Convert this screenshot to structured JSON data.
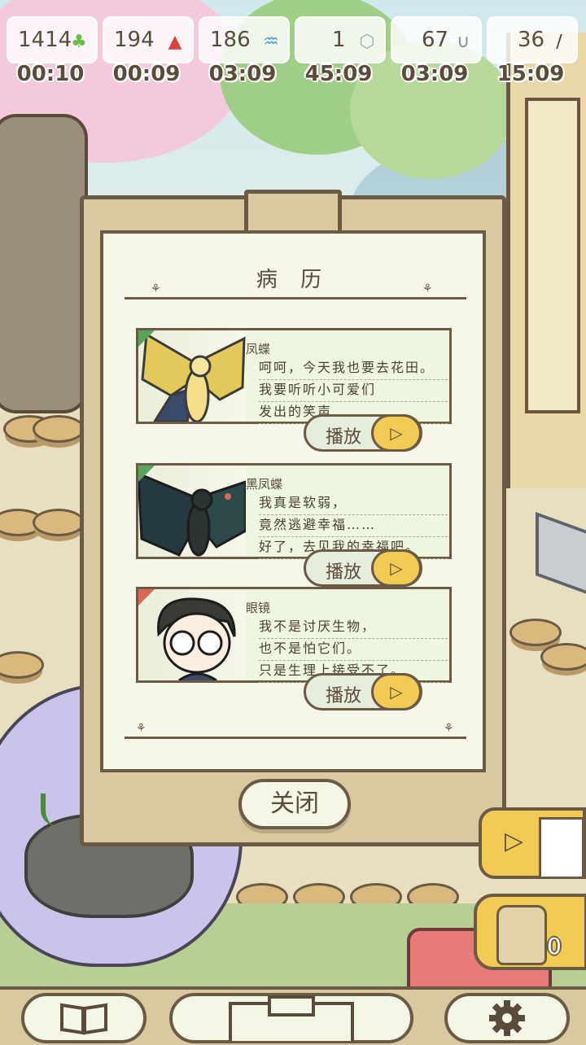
{
  "resources": [
    {
      "count": "1414",
      "timer": "00:10",
      "icon": "clover-icon"
    },
    {
      "count": "194",
      "timer": "00:09",
      "icon": "red-crystal-icon"
    },
    {
      "count": "186",
      "timer": "03:09",
      "icon": "water-drop-icon"
    },
    {
      "count": "1",
      "timer": "45:09",
      "icon": "shell-icon"
    },
    {
      "count": "67",
      "timer": "03:09",
      "icon": "paperclip-icon"
    },
    {
      "count": "36",
      "timer": "15:09",
      "icon": "feather-icon"
    }
  ],
  "dialog": {
    "title": "病 历",
    "close_label": "关闭"
  },
  "records": [
    {
      "speaker": "凤蝶",
      "lines": [
        "呵呵，今天我也要去花田。",
        "我要听听小可爱们",
        "发出的笑声……"
      ],
      "play_label": "播放",
      "corner_color": "#5aa35a"
    },
    {
      "speaker": "黑凤蝶",
      "lines": [
        "我真是软弱，",
        "竟然逃避幸福……",
        "好了，去见我的幸福吧。"
      ],
      "play_label": "播放",
      "corner_color": "#5aa35a"
    },
    {
      "speaker": "眼镜",
      "lines": [
        "我不是讨厌生物，",
        "也不是怕它们。",
        "只是生理上接受不了。"
      ],
      "play_label": "播放",
      "corner_color": "#d66a56"
    }
  ],
  "side": {
    "seed_count": "0"
  },
  "bottom_nav": {
    "items": [
      "book-icon",
      "clipboard-icon",
      "gear-icon"
    ]
  },
  "colors": {
    "accent": "#f2cb55",
    "outline": "#6b5a44",
    "paper": "#f6f6ea"
  }
}
